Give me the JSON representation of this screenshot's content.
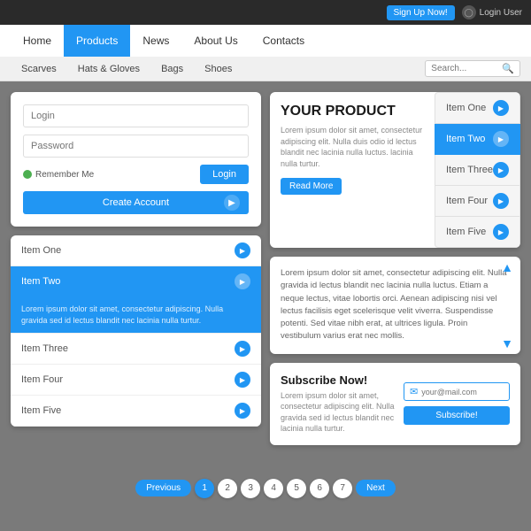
{
  "topbar": {
    "signup_label": "Sign Up Now!",
    "login_label": "Login User"
  },
  "mainnav": {
    "items": [
      {
        "label": "Home",
        "active": false
      },
      {
        "label": "Products",
        "active": true
      },
      {
        "label": "News",
        "active": false
      },
      {
        "label": "About Us",
        "active": false
      },
      {
        "label": "Contacts",
        "active": false
      }
    ]
  },
  "subnav": {
    "items": [
      {
        "label": "Scarves"
      },
      {
        "label": "Hats & Gloves"
      },
      {
        "label": "Bags"
      },
      {
        "label": "Shoes"
      }
    ],
    "search_placeholder": "Search..."
  },
  "login": {
    "login_placeholder": "Login",
    "password_placeholder": "Password",
    "remember_label": "Remember Me",
    "login_btn": "Login",
    "create_label": "Create Account"
  },
  "product": {
    "title": "YOUR PRODUCT",
    "text": "Lorem ipsum dolor sit amet, consectetur adipiscing elit. Nulla duis odio id lectus blandit nec lacinia nulla luctus. lacinia nulla turtur.",
    "read_more": "Read More"
  },
  "items_sidebar": {
    "items": [
      {
        "label": "Item One",
        "active": false
      },
      {
        "label": "Item Two",
        "active": true
      },
      {
        "label": "Item Three",
        "active": false
      },
      {
        "label": "Item Four",
        "active": false
      },
      {
        "label": "Item Five",
        "active": false
      }
    ]
  },
  "accordion": {
    "items": [
      {
        "label": "Item One",
        "active": false,
        "body": ""
      },
      {
        "label": "Item Two",
        "active": true,
        "body": "Lorem ipsum dolor sit amet, consectetur adipiscing. Nulla gravida sed id lectus blandit nec lacinia nulla turtur."
      },
      {
        "label": "Item Three",
        "active": false,
        "body": ""
      },
      {
        "label": "Item Four",
        "active": false,
        "body": ""
      },
      {
        "label": "Item Five",
        "active": false,
        "body": ""
      }
    ]
  },
  "scroll_text": "Lorem ipsum dolor sit amet, consectetur adipiscing elit. Nulla gravida id lectus blandit nec lacinia nulla luctus. Etiam a neque lectus, vitae lobortis orci. Aenean adipiscing nisi vel lectus facilisis eget scelerisque velit viverra. Suspendisse potenti. Sed vitae nibh erat, at ultrices ligula. Proin vestibulum varius erat nec mollis.",
  "subscribe": {
    "title": "Subscribe Now!",
    "text": "Lorem ipsum dolor sit amet, consectetur adipiscing elit. Nulla gravida sed id lectus blandit nec lacinia nulla turtur.",
    "email_placeholder": "your@mail.com",
    "btn_label": "Subscribe!"
  },
  "pagination": {
    "prev": "Previous",
    "next": "Next",
    "pages": [
      "1",
      "2",
      "3",
      "4",
      "5",
      "6",
      "7"
    ],
    "active_page": "1"
  }
}
